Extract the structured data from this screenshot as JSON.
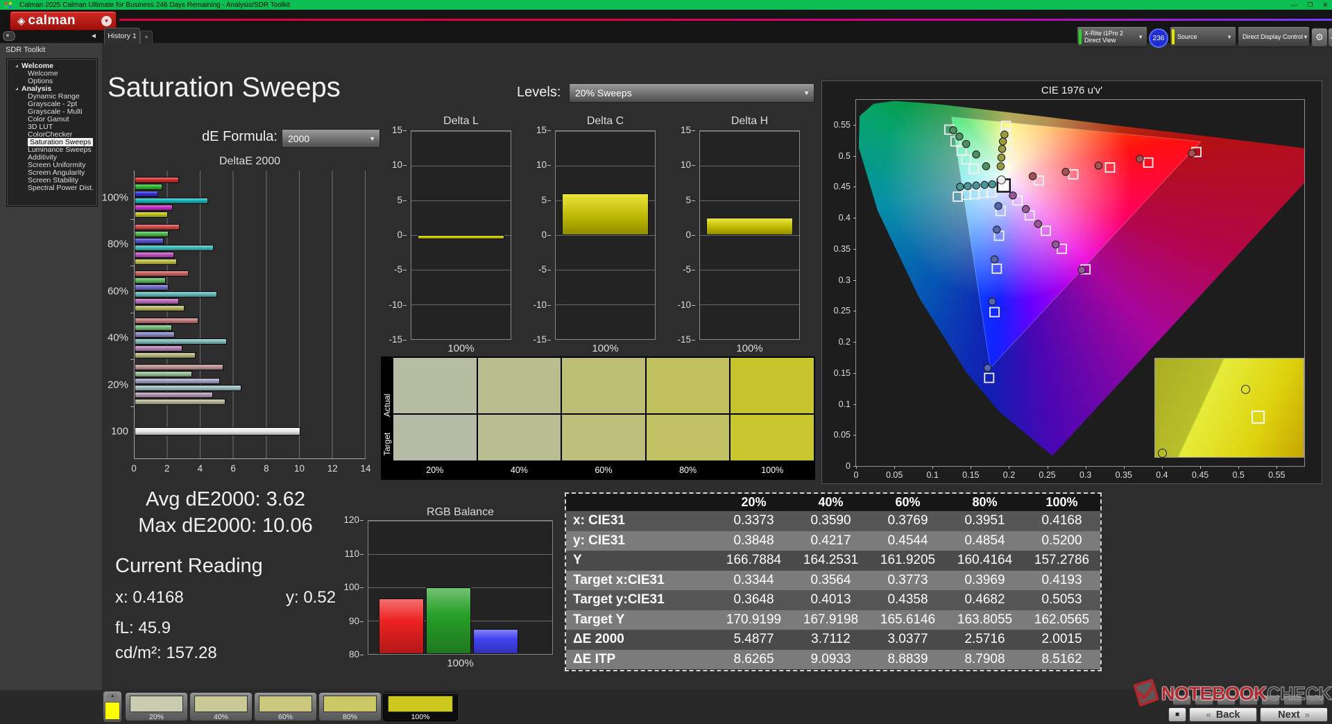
{
  "titlebar": {
    "title": "Calman 2025 Calman Ultimate for Business 246 Days Remaining  - Analysis/SDR Toolkit",
    "window_controls": {
      "minimize": "—",
      "maximize": "❐",
      "close": "✕"
    }
  },
  "logo": {
    "brand": "calman",
    "diamond_icon": "◈",
    "dropdown_icon": "▾"
  },
  "tabs": {
    "history_label": "History 1",
    "add_label": "+",
    "collapse_icon": "◀"
  },
  "toolbar": {
    "meter_line1": "X-Rite i1Pro 2",
    "meter_line2": "Direct View",
    "badge": "236",
    "source_label": "Source",
    "display_control_label": "Direct Display Control",
    "gear_icon": "⚙",
    "arrow_icon": "◀",
    "meter_stripe_color": "#27d427",
    "source_stripe_color": "#e6e600",
    "ddc_stripe_color": "#e6e600"
  },
  "sidebar": {
    "header": "SDR Toolkit",
    "tree": [
      {
        "label": "Welcome",
        "type": "group"
      },
      {
        "label": "Welcome",
        "type": "item"
      },
      {
        "label": "Options",
        "type": "item"
      },
      {
        "label": "Analysis",
        "type": "group"
      },
      {
        "label": "Dynamic Range",
        "type": "item"
      },
      {
        "label": "Grayscale - 2pt",
        "type": "item"
      },
      {
        "label": "Grayscale - Multi",
        "type": "item"
      },
      {
        "label": "Color Gamut",
        "type": "item"
      },
      {
        "label": "3D LUT",
        "type": "item"
      },
      {
        "label": "ColorChecker",
        "type": "item"
      },
      {
        "label": "Saturation Sweeps",
        "type": "item",
        "selected": true
      },
      {
        "label": "Luminance Sweeps",
        "type": "item"
      },
      {
        "label": "Additivity",
        "type": "item"
      },
      {
        "label": "Screen Uniformity",
        "type": "item"
      },
      {
        "label": "Screen Angularity",
        "type": "item"
      },
      {
        "label": "Screen Stability",
        "type": "item"
      },
      {
        "label": "Spectral Power Dist.",
        "type": "item"
      }
    ]
  },
  "page": {
    "title": "Saturation Sweeps",
    "de_formula_label": "dE Formula:",
    "de_formula_value": "2000",
    "levels_label": "Levels:",
    "levels_value": "20% Sweeps"
  },
  "readings": {
    "avg": "Avg dE2000: 3.62",
    "max": "Max dE2000: 10.06",
    "current_header": "Current Reading",
    "x": "x: 0.4168",
    "y": "y: 0.52",
    "fl": "fL: 45.9",
    "cd": "cd/m²: 157.28"
  },
  "swatch_panel": {
    "row_labels": [
      "Actual",
      "Target"
    ],
    "columns": [
      "20%",
      "40%",
      "60%",
      "80%",
      "100%"
    ],
    "actual_colors": [
      "#b7bda2",
      "#babd8e",
      "#bdbe76",
      "#c0c05f",
      "#c6c52b"
    ],
    "target_colors": [
      "#b5bba4",
      "#b9bd92",
      "#bebf7b",
      "#c1c264",
      "#c9c72e"
    ]
  },
  "bottom_bar": {
    "collapse_icon": "▲",
    "quick_swatch_color": "#ffff00",
    "buttons": [
      {
        "label": "20%",
        "color": "#c9cbb0",
        "selected": false
      },
      {
        "label": "40%",
        "color": "#c9c995",
        "selected": false
      },
      {
        "label": "60%",
        "color": "#cac87c",
        "selected": false
      },
      {
        "label": "80%",
        "color": "#cbc966",
        "selected": false
      },
      {
        "label": "100%",
        "color": "#cbc71f",
        "selected": true
      }
    ]
  },
  "watermark": {
    "part1": "NOTEBOOK",
    "part2": "CHECK"
  },
  "nav": {
    "stop_icon": "■",
    "back_chevron": "«",
    "back_label": "Back",
    "next_label": "Next",
    "next_chevron": "»"
  },
  "chart_data": [
    {
      "id": "deltae2000",
      "type": "bar",
      "orientation": "horizontal",
      "title": "DeltaE 2000",
      "xlim": [
        0,
        14
      ],
      "x_ticks": [
        0,
        2,
        4,
        6,
        8,
        10,
        12,
        14
      ],
      "series_order": [
        "red",
        "green",
        "blue",
        "cyan",
        "magenta",
        "yellow"
      ],
      "groups": [
        {
          "label": "100%",
          "values": [
            2.7,
            1.7,
            1.45,
            4.45,
            2.33,
            2.0
          ],
          "colors": [
            "#d42b2b",
            "#2eba2e",
            "#3030d8",
            "#12b8b8",
            "#c62cc6",
            "#c2c21e"
          ]
        },
        {
          "label": "80%",
          "values": [
            2.73,
            2.04,
            1.75,
            4.8,
            2.4,
            2.57
          ],
          "colors": [
            "#d04747",
            "#48ba48",
            "#5050cc",
            "#3cb9b9",
            "#c04fc0",
            "#bdbd43"
          ]
        },
        {
          "label": "60%",
          "values": [
            3.27,
            1.89,
            2.04,
            5.0,
            2.69,
            3.04
          ],
          "colors": [
            "#cb6060",
            "#60bb60",
            "#6c6cc8",
            "#60baba",
            "#bb6abb",
            "#b9b95f"
          ]
        },
        {
          "label": "40%",
          "values": [
            3.85,
            2.25,
            2.44,
            5.6,
            2.91,
            3.71
          ],
          "colors": [
            "#c57a7a",
            "#79bc79",
            "#8686c4",
            "#80bcbc",
            "#b781b7",
            "#b6b679"
          ]
        },
        {
          "label": "20%",
          "values": [
            5.38,
            3.49,
            5.16,
            6.47,
            4.73,
            5.49
          ],
          "colors": [
            "#bd9292",
            "#93bd93",
            "#a0a0c1",
            "#9cbebe",
            "#b297b2",
            "#b3b394"
          ]
        },
        {
          "label": "100",
          "values": [
            10.06
          ],
          "colors": [
            "#ededed"
          ]
        }
      ]
    },
    {
      "id": "delta_l",
      "type": "bar",
      "title": "Delta L",
      "ylim": [
        -15,
        15
      ],
      "y_ticks": [
        15,
        10,
        5,
        0,
        -5,
        -10,
        -15
      ],
      "xlabel": "100%",
      "value": -0.6,
      "bar_color": "#c8c400"
    },
    {
      "id": "delta_c",
      "type": "bar",
      "title": "Delta C",
      "ylim": [
        -15,
        15
      ],
      "y_ticks": [
        15,
        10,
        5,
        0,
        -5,
        -10,
        -15
      ],
      "xlabel": "100%",
      "value": 6.0,
      "bar_color": "#c8c400"
    },
    {
      "id": "delta_h",
      "type": "bar",
      "title": "Delta H",
      "ylim": [
        -15,
        15
      ],
      "y_ticks": [
        15,
        10,
        5,
        0,
        -5,
        -10,
        -15
      ],
      "xlabel": "100%",
      "value": 2.5,
      "bar_color": "#c8c400"
    },
    {
      "id": "rgb_balance",
      "type": "bar",
      "title": "RGB Balance",
      "ylim": [
        80,
        120
      ],
      "y_ticks": [
        120,
        110,
        100,
        90,
        80
      ],
      "xlabel": "100%",
      "categories": [
        "Red",
        "Green",
        "Blue"
      ],
      "values": [
        96.7,
        100.0,
        87.4
      ],
      "colors": [
        "#ee2222",
        "#28a028",
        "#4242f2"
      ]
    },
    {
      "id": "cie_diagram",
      "type": "scatter",
      "title": "CIE 1976 u'v'",
      "xlabel": "u'",
      "ylabel": "v'",
      "u_max": 0.586,
      "v_max": 0.59,
      "x_ticks": [
        "0",
        "0.05",
        "0.1",
        "0.15",
        "0.2",
        "0.25",
        "0.3",
        "0.35",
        "0.4",
        "0.45",
        "0.5",
        "0.55"
      ],
      "y_ticks": [
        "0",
        "0.05",
        "0.1",
        "0.15",
        "0.2",
        "0.25",
        "0.3",
        "0.35",
        "0.4",
        "0.45",
        "0.5",
        "0.55"
      ],
      "gamut_triangle": [
        [
          0.4507,
          0.5229
        ],
        [
          0.125,
          0.5625
        ],
        [
          0.1754,
          0.1579
        ]
      ],
      "white_point": {
        "target": [
          0.193,
          0.452
        ],
        "measured": [
          0.19,
          0.461
        ]
      },
      "series": [
        {
          "name": "red",
          "color": "#a65252",
          "target": [
            [
              0.239,
              0.46
            ],
            [
              0.284,
              0.47
            ],
            [
              0.332,
              0.481
            ],
            [
              0.382,
              0.489
            ],
            [
              0.445,
              0.506
            ]
          ],
          "measured": [
            [
              0.231,
              0.467
            ],
            [
              0.274,
              0.474
            ],
            [
              0.317,
              0.484
            ],
            [
              0.371,
              0.495
            ],
            [
              0.439,
              0.504
            ]
          ]
        },
        {
          "name": "green",
          "color": "#4f8f63",
          "target": [
            [
              0.154,
              0.479
            ],
            [
              0.144,
              0.494
            ],
            [
              0.138,
              0.508
            ],
            [
              0.13,
              0.523
            ],
            [
              0.122,
              0.542
            ]
          ],
          "measured": [
            [
              0.17,
              0.483
            ],
            [
              0.157,
              0.502
            ],
            [
              0.144,
              0.519
            ],
            [
              0.135,
              0.531
            ],
            [
              0.127,
              0.541
            ]
          ]
        },
        {
          "name": "blue",
          "color": "#5565b0",
          "target": [
            [
              0.189,
              0.411
            ],
            [
              0.187,
              0.371
            ],
            [
              0.184,
              0.318
            ],
            [
              0.181,
              0.248
            ],
            [
              0.174,
              0.142
            ]
          ],
          "measured": [
            [
              0.186,
              0.419
            ],
            [
              0.184,
              0.381
            ],
            [
              0.181,
              0.333
            ],
            [
              0.178,
              0.265
            ],
            [
              0.172,
              0.158
            ]
          ]
        },
        {
          "name": "cyan",
          "color": "#4a9595",
          "target": [
            [
              0.177,
              0.441
            ],
            [
              0.166,
              0.44
            ],
            [
              0.155,
              0.438
            ],
            [
              0.144,
              0.437
            ],
            [
              0.133,
              0.434
            ]
          ],
          "measured": [
            [
              0.178,
              0.454
            ],
            [
              0.168,
              0.453
            ],
            [
              0.157,
              0.452
            ],
            [
              0.146,
              0.451
            ],
            [
              0.136,
              0.45
            ]
          ]
        },
        {
          "name": "magenta",
          "color": "#965896",
          "target": [
            [
              0.211,
              0.428
            ],
            [
              0.227,
              0.404
            ],
            [
              0.248,
              0.379
            ],
            [
              0.269,
              0.35
            ],
            [
              0.3,
              0.317
            ]
          ],
          "measured": [
            [
              0.205,
              0.436
            ],
            [
              0.222,
              0.414
            ],
            [
              0.238,
              0.39
            ],
            [
              0.261,
              0.357
            ],
            [
              0.295,
              0.316
            ]
          ]
        },
        {
          "name": "yellow",
          "color": "#9a9a3e",
          "target": [
            [
              0.2,
              0.483
            ],
            [
              0.199,
              0.502
            ],
            [
              0.197,
              0.519
            ],
            [
              0.196,
              0.536
            ],
            [
              0.196,
              0.548
            ]
          ],
          "measured": [
            [
              0.189,
              0.483
            ],
            [
              0.19,
              0.497
            ],
            [
              0.191,
              0.511
            ],
            [
              0.192,
              0.523
            ],
            [
              0.194,
              0.534
            ]
          ]
        }
      ],
      "inset_markers": {
        "circles": [
          [
            58,
            27
          ],
          [
            2,
            92
          ]
        ],
        "squares": [
          [
            65,
            53
          ]
        ]
      }
    },
    {
      "id": "sweep_table",
      "type": "table",
      "headers": [
        "",
        "20%",
        "40%",
        "60%",
        "80%",
        "100%"
      ],
      "rows": [
        [
          "x: CIE31",
          "0.3373",
          "0.3590",
          "0.3769",
          "0.3951",
          "0.4168"
        ],
        [
          "y: CIE31",
          "0.3848",
          "0.4217",
          "0.4544",
          "0.4854",
          "0.5200"
        ],
        [
          "Y",
          "166.7884",
          "164.2531",
          "161.9205",
          "160.4164",
          "157.2786"
        ],
        [
          "Target x:CIE31",
          "0.3344",
          "0.3564",
          "0.3773",
          "0.3969",
          "0.4193"
        ],
        [
          "Target y:CIE31",
          "0.3648",
          "0.4013",
          "0.4358",
          "0.4682",
          "0.5053"
        ],
        [
          "Target Y",
          "170.9199",
          "167.9198",
          "165.6146",
          "163.8055",
          "162.0565"
        ],
        [
          "ΔE 2000",
          "5.4877",
          "3.7112",
          "3.0377",
          "2.5716",
          "2.0015"
        ],
        [
          "ΔE ITP",
          "8.6265",
          "9.0933",
          "8.8839",
          "8.7908",
          "8.5162"
        ]
      ]
    }
  ]
}
